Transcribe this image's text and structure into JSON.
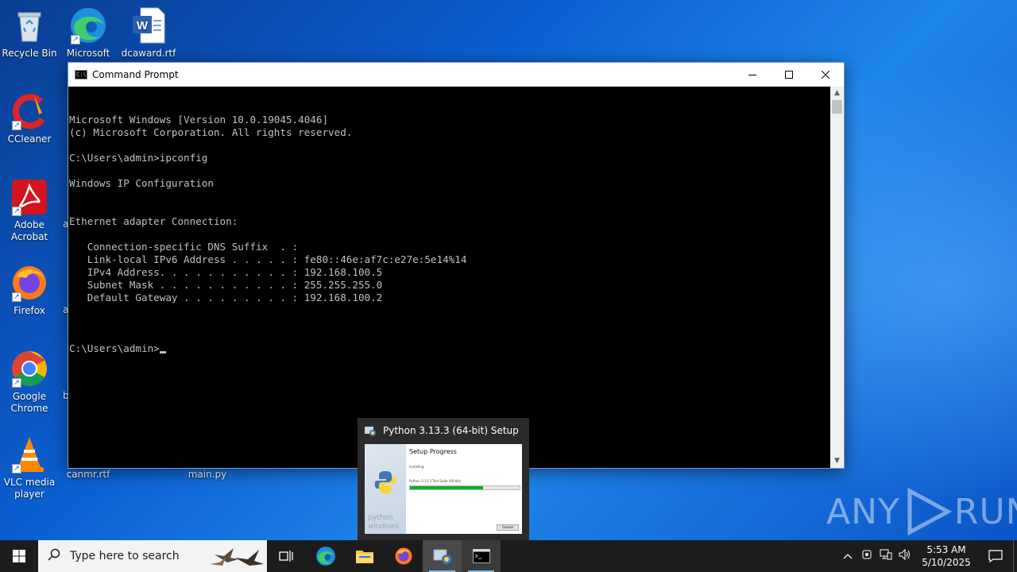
{
  "desktop": {
    "icons": [
      {
        "label": "Recycle Bin"
      },
      {
        "label": "Microsoft Edge"
      },
      {
        "label": "dcaward.rtf"
      },
      {
        "label": "CCleaner"
      },
      {
        "label": "Adobe Acrobat"
      },
      {
        "label": "Firefox"
      },
      {
        "label": "Google Chrome"
      },
      {
        "label": "VLC media player"
      },
      {
        "label": "canmr.rtf"
      },
      {
        "label": "main.py"
      }
    ],
    "partial_labels": [
      "a",
      "a",
      "b"
    ]
  },
  "cmd": {
    "title": "Command Prompt",
    "lines": [
      "Microsoft Windows [Version 10.0.19045.4046]",
      "(c) Microsoft Corporation. All rights reserved.",
      "",
      "C:\\Users\\admin>ipconfig",
      "",
      "Windows IP Configuration",
      "",
      "",
      "Ethernet adapter Connection:",
      "",
      "   Connection-specific DNS Suffix  . :",
      "   Link-local IPv6 Address . . . . . : fe80::46e:af7c:e27e:5e14%14",
      "   IPv4 Address. . . . . . . . . . . : 192.168.100.5",
      "   Subnet Mask . . . . . . . . . . . : 255.255.255.0",
      "   Default Gateway . . . . . . . . . : 192.168.100.2",
      ""
    ],
    "prompt": "C:\\Users\\admin>"
  },
  "preview": {
    "title": "Python 3.13.3 (64-bit) Setup",
    "thumb_title": "Setup Progress",
    "thumb_installing": "Installing:",
    "thumb_file": "Python 3.13.3 Test Suite (64-bit)",
    "thumb_progress": 0.67,
    "thumb_side_text": "python\nwindows",
    "thumb_cancel": "Cancel"
  },
  "watermark": {
    "text_left": "ANY",
    "text_right": "RUN"
  },
  "taskbar": {
    "search_placeholder": "Type here to search",
    "clock_time": "5:53 AM",
    "clock_date": "5/10/2025"
  },
  "colors": {
    "accent": "#76b9ed",
    "progress": "#06b025",
    "taskbar": "#1c1c1c"
  }
}
